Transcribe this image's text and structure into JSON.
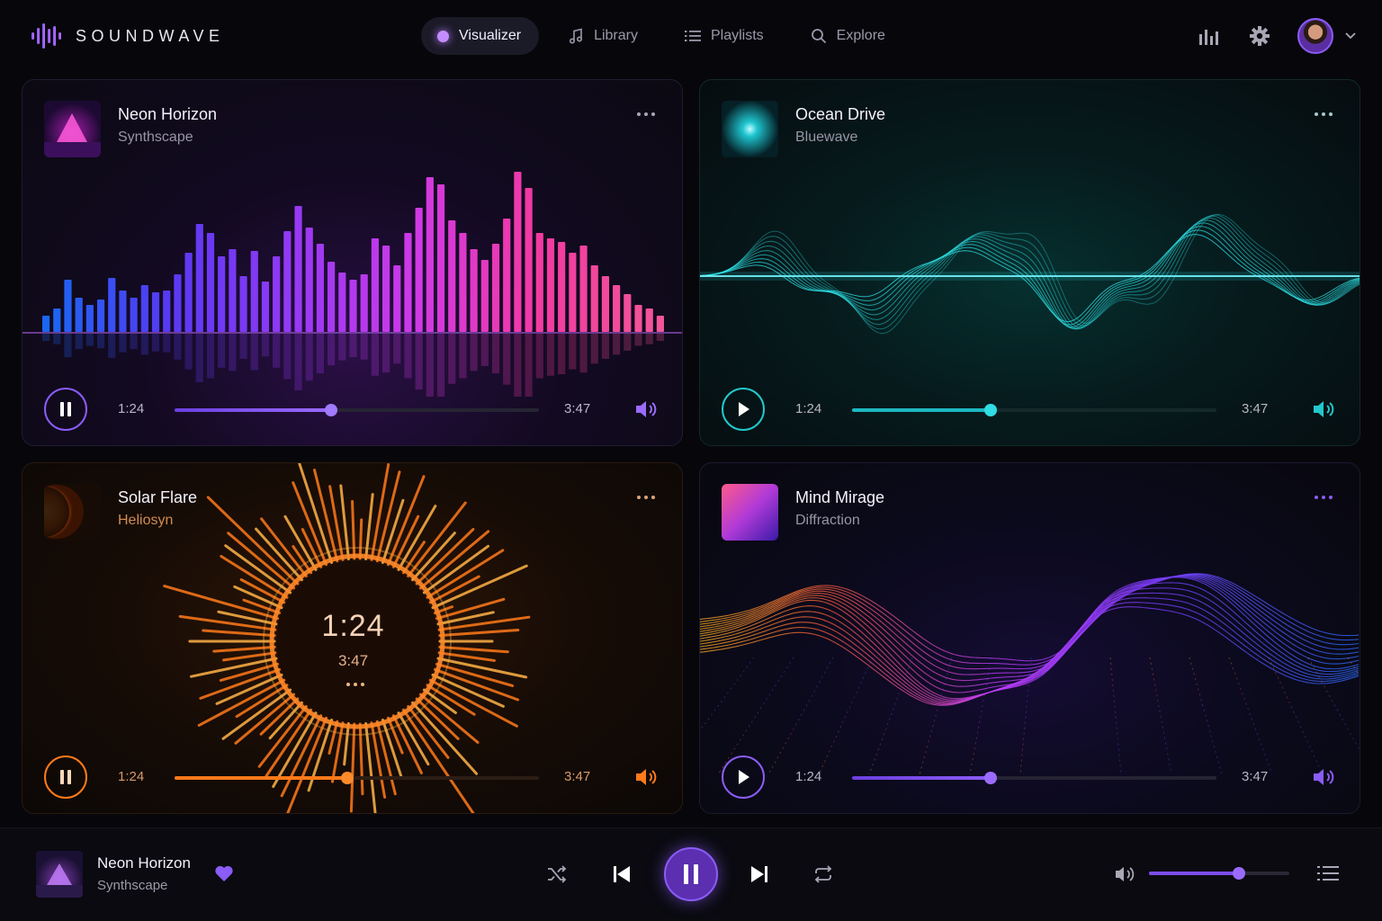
{
  "app": {
    "name": "SOUNDWAVE"
  },
  "nav": [
    {
      "label": "Visualizer",
      "icon": "dot-icon",
      "active": true
    },
    {
      "label": "Library",
      "icon": "music-note-icon",
      "active": false
    },
    {
      "label": "Playlists",
      "icon": "list-icon",
      "active": false
    },
    {
      "label": "Explore",
      "icon": "search-icon",
      "active": false
    }
  ],
  "header_icons": [
    "equalizer-icon",
    "gear-icon",
    "avatar",
    "chevron-down-icon"
  ],
  "cards": [
    {
      "id": "neon",
      "title": "Neon Horizon",
      "artist": "Synthscape",
      "state": "playing",
      "current": "1:24",
      "duration": "3:47",
      "progress": 0.43,
      "accent": "#8b5cf6",
      "visual": "bar-spectrum"
    },
    {
      "id": "ocean",
      "title": "Ocean Drive",
      "artist": "Bluewave",
      "state": "paused",
      "current": "1:24",
      "duration": "3:47",
      "progress": 0.38,
      "accent": "#22c8cc",
      "visual": "sine-wave"
    },
    {
      "id": "solar",
      "title": "Solar Flare",
      "artist": "Heliosyn",
      "state": "playing",
      "current": "1:24",
      "duration": "3:47",
      "progress": 0.475,
      "accent": "#ff7a1a",
      "visual": "radial-burst",
      "center_time": "1:24",
      "center_duration": "3:47"
    },
    {
      "id": "mind",
      "title": "Mind Mirage",
      "artist": "Diffraction",
      "state": "paused",
      "current": "1:24",
      "duration": "3:47",
      "progress": 0.38,
      "accent": "#8b5cf6",
      "visual": "spectral-wave"
    }
  ],
  "now_playing": {
    "title": "Neon Horizon",
    "artist": "Synthscape",
    "liked": true,
    "volume": 0.64,
    "accent": "#8b5cf6"
  }
}
